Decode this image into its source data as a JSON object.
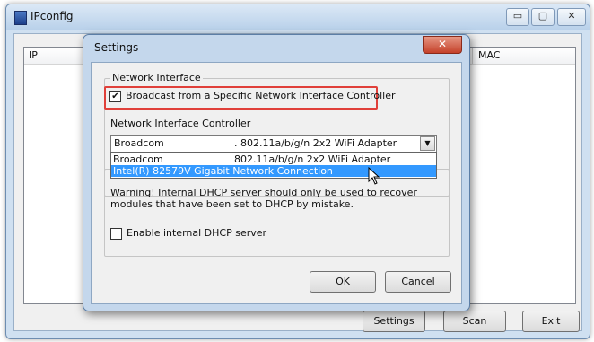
{
  "main_window": {
    "title": "IPconfig",
    "minimize_glyph": "▭",
    "maximize_glyph": "▢",
    "close_glyph": "✕",
    "columns": [
      "IP",
      "MAC"
    ],
    "buttons": {
      "settings": "Settings",
      "scan": "Scan",
      "exit": "Exit"
    }
  },
  "settings_dialog": {
    "title": "Settings",
    "close_glyph": "✕",
    "network_interface_group": {
      "title": "Network Interface",
      "broadcast_checkbox_label": "Broadcast from a Specific Network Interface Controller",
      "broadcast_checked": true,
      "nic_label": "Network Interface Controller",
      "nic_selected_vendor": "Broadcom",
      "nic_selected_model": ". 802.11a/b/g/n 2x2 WiFi Adapter",
      "nic_options": [
        {
          "vendor": "Broadcom",
          "model": "802.11a/b/g/n 2x2 WiFi Adapter",
          "selected": false
        },
        {
          "vendor": "Intel(R) 82579V Gigabit Network Connection",
          "model": "",
          "selected": true
        }
      ]
    },
    "dhcp_group": {
      "warning": "Warning! Internal DHCP server should only be used to recover modules that have been set to DHCP by mistake.",
      "enable_checkbox_label": "Enable internal DHCP server",
      "enable_checked": false
    },
    "buttons": {
      "ok": "OK",
      "cancel": "Cancel"
    }
  },
  "colors": {
    "highlight_border": "#e0403a",
    "selection": "#3399ff",
    "close_button": "#c4412a"
  }
}
